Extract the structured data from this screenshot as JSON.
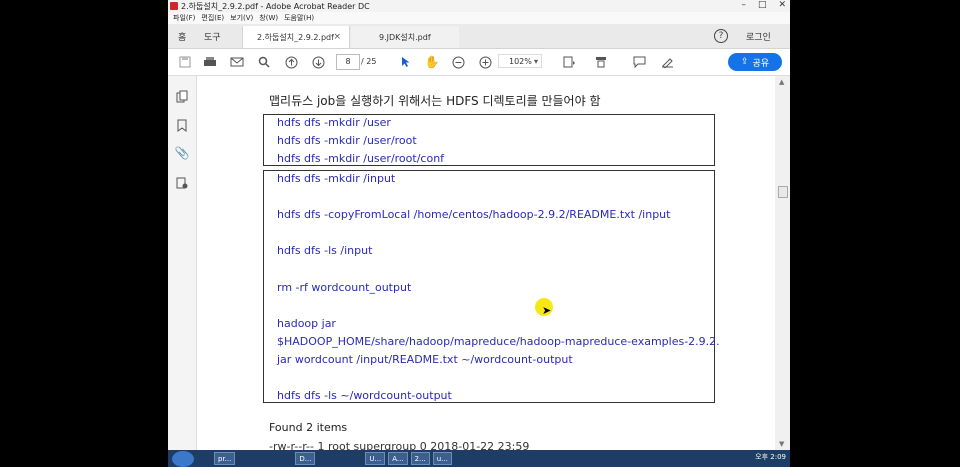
{
  "window": {
    "title": "2.하둡설치_2.9.2.pdf - Adobe Acrobat Reader DC",
    "controls": [
      "–",
      "□",
      "✕"
    ]
  },
  "menubar": [
    "파일(F)",
    "편집(E)",
    "보기(V)",
    "창(W)",
    "도움말(H)"
  ],
  "tabs": {
    "home": "홈",
    "tools": "도구",
    "doc1": "2.하둡설치_2.9.2.pdf",
    "doc2": "9.JDK설치.pdf",
    "close": "×",
    "help": "?",
    "login": "로그인"
  },
  "toolbar": {
    "page_current": "8",
    "page_total": "/ 25",
    "zoom": "102%",
    "share": "공유"
  },
  "document": {
    "heading": "맵리듀스 job을 실행하기 위해서는 HDFS 디렉토리를 만들어야 함",
    "box1": [
      "hdfs  dfs  -mkdir /user",
      "hdfs  dfs  -mkdir /user/root",
      "hdfs  dfs  -mkdir /user/root/conf"
    ],
    "box2": [
      "hdfs  dfs  -mkdir /input",
      "hdfs  dfs  -copyFromLocal  /home/centos/hadoop-2.9.2/README.txt  /input",
      "hdfs  dfs  -ls  /input",
      "rm  -rf  wordcount_output",
      "hadoop  jar",
      "$HADOOP_HOME/share/hadoop/mapreduce/hadoop-mapreduce-examples-2.9.2.",
      "jar  wordcount  /input/README.txt  ~/wordcount-output",
      "hdfs  dfs  -ls  ~/wordcount-output"
    ],
    "found": "Found  2  items",
    "ls_row": "-rw-r--r--        1    root    supergroup                          0    2018-01-22    23:59"
  },
  "taskbar": {
    "items": [
      "pr...",
      "D...",
      "U...",
      "A...",
      "2...",
      "u..."
    ],
    "tray_clock": "오후 2:09"
  }
}
